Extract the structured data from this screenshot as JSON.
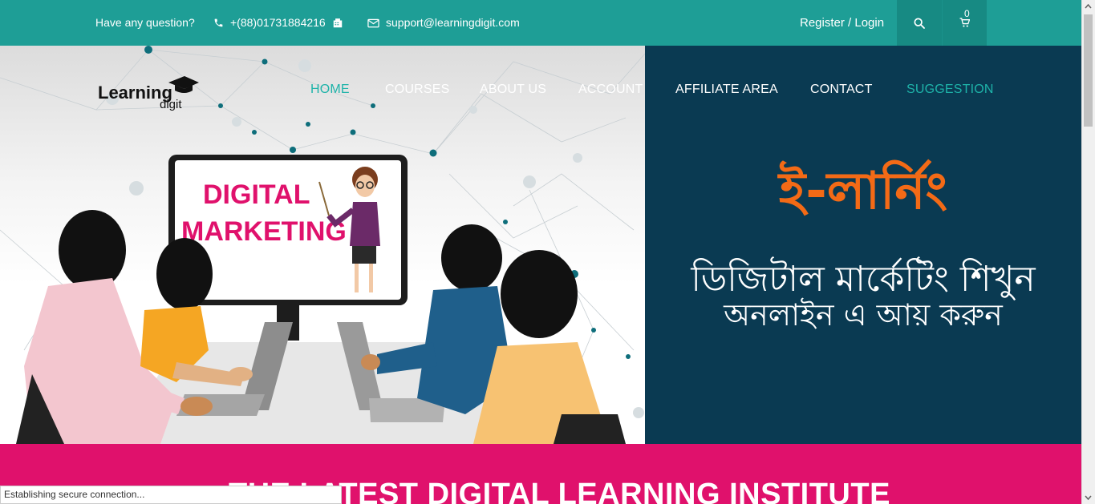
{
  "topbar": {
    "question": "Have any question?",
    "phone": "+(88)01731884216",
    "email": "support@learningdigit.com",
    "register_login": "Register / Login",
    "cart_count": "0"
  },
  "logo": {
    "line1": "Learning",
    "line2": "digit"
  },
  "nav": {
    "items": [
      {
        "label": "HOME"
      },
      {
        "label": "COURSES"
      },
      {
        "label": "ABOUT US"
      },
      {
        "label": "ACCOUNT"
      },
      {
        "label": "AFFILIATE AREA"
      },
      {
        "label": "CONTACT"
      },
      {
        "label": "SUGGESTION"
      }
    ]
  },
  "hero": {
    "screen_line1": "DIGITAL",
    "screen_line2": "MARKETING",
    "banner_title": "ই-লার্নিং",
    "banner_line1": "ডিজিটাল মার্কেটিং শিখুন",
    "banner_line2": "অনলাইন এ আয় করুন"
  },
  "tagline": "THE LATEST DIGITAL LEARNING  INSTITUTE",
  "status_bar": "Establishing secure connection...",
  "colors": {
    "teal": "#1e9e96",
    "navy": "#0a3a52",
    "pink": "#e0116c",
    "orange": "#f36a16"
  }
}
